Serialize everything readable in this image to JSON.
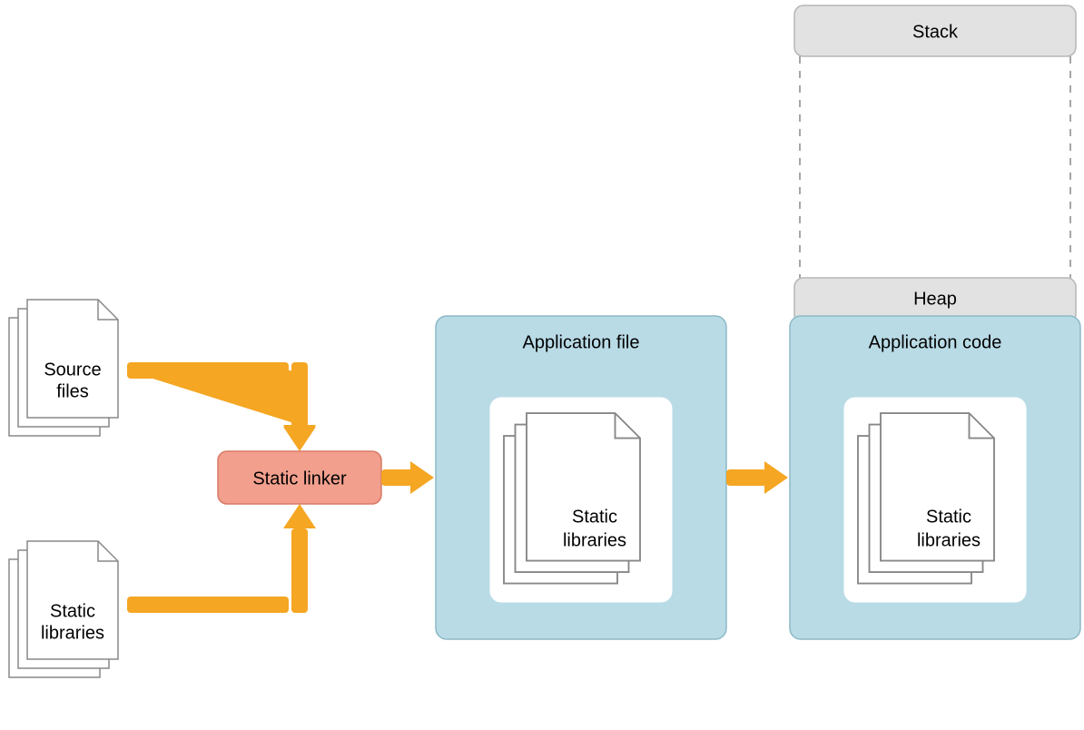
{
  "nodes": {
    "source_files": {
      "line1": "Source",
      "line2": "files"
    },
    "static_libs_input": {
      "line1": "Static",
      "line2": "libraries"
    },
    "linker": {
      "label": "Static linker"
    },
    "app_file": {
      "title": "Application file",
      "inner": {
        "line1": "Static",
        "line2": "libraries"
      }
    },
    "stack": {
      "label": "Stack"
    },
    "heap": {
      "label": "Heap"
    },
    "app_code": {
      "title": "Application code",
      "inner": {
        "line1": "Static",
        "line2": "libraries"
      }
    }
  },
  "colors": {
    "grey_stroke": "#888888",
    "box_fill_blue": "#b9dbe6",
    "box_stroke_blue": "#8db9c7",
    "box_fill_grey": "#e2e2e2",
    "box_stroke_grey": "#b6b6b6",
    "linker_fill": "#f29f8d",
    "linker_stroke": "#d77a66",
    "arrow": "#f5a623",
    "page_fill": "#ffffff"
  }
}
